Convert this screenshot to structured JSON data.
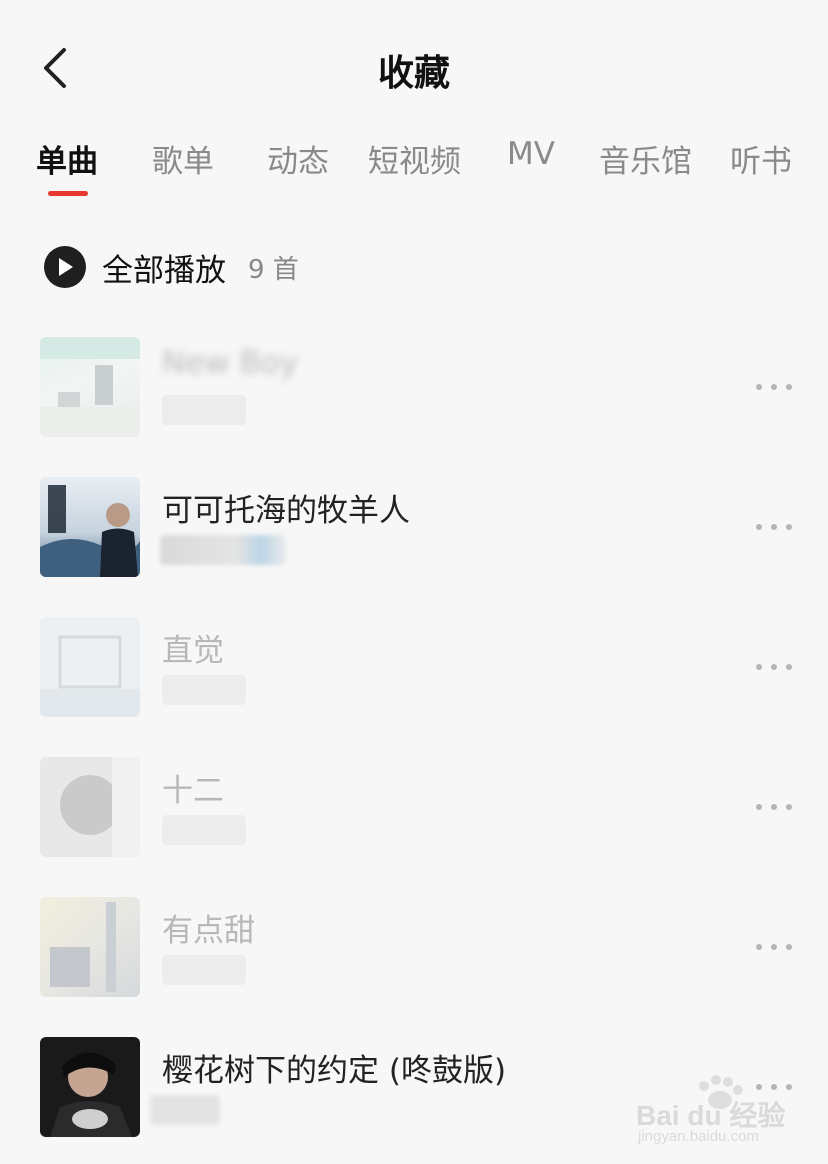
{
  "header": {
    "title": "收藏"
  },
  "tabs": [
    {
      "label": "单曲",
      "active": true
    },
    {
      "label": "歌单"
    },
    {
      "label": "动态"
    },
    {
      "label": "短视频"
    },
    {
      "label": "MV"
    },
    {
      "label": "音乐馆"
    },
    {
      "label": "听书"
    }
  ],
  "play_all": {
    "label": "全部播放",
    "count": "9 首"
  },
  "songs": [
    {
      "title": "New Boy",
      "available": false
    },
    {
      "title": "可可托海的牧羊人",
      "available": true
    },
    {
      "title": "直觉",
      "available": false
    },
    {
      "title": "十二",
      "available": false
    },
    {
      "title": "有点甜",
      "available": false
    },
    {
      "title": "樱花树下的约定 (咚鼓版)",
      "available": true
    }
  ],
  "colors": {
    "accent": "#e8392f",
    "background": "#f7f7f7"
  },
  "watermark": {
    "brand": "Bai du 经验",
    "url": "jingyan.baidu.com"
  }
}
